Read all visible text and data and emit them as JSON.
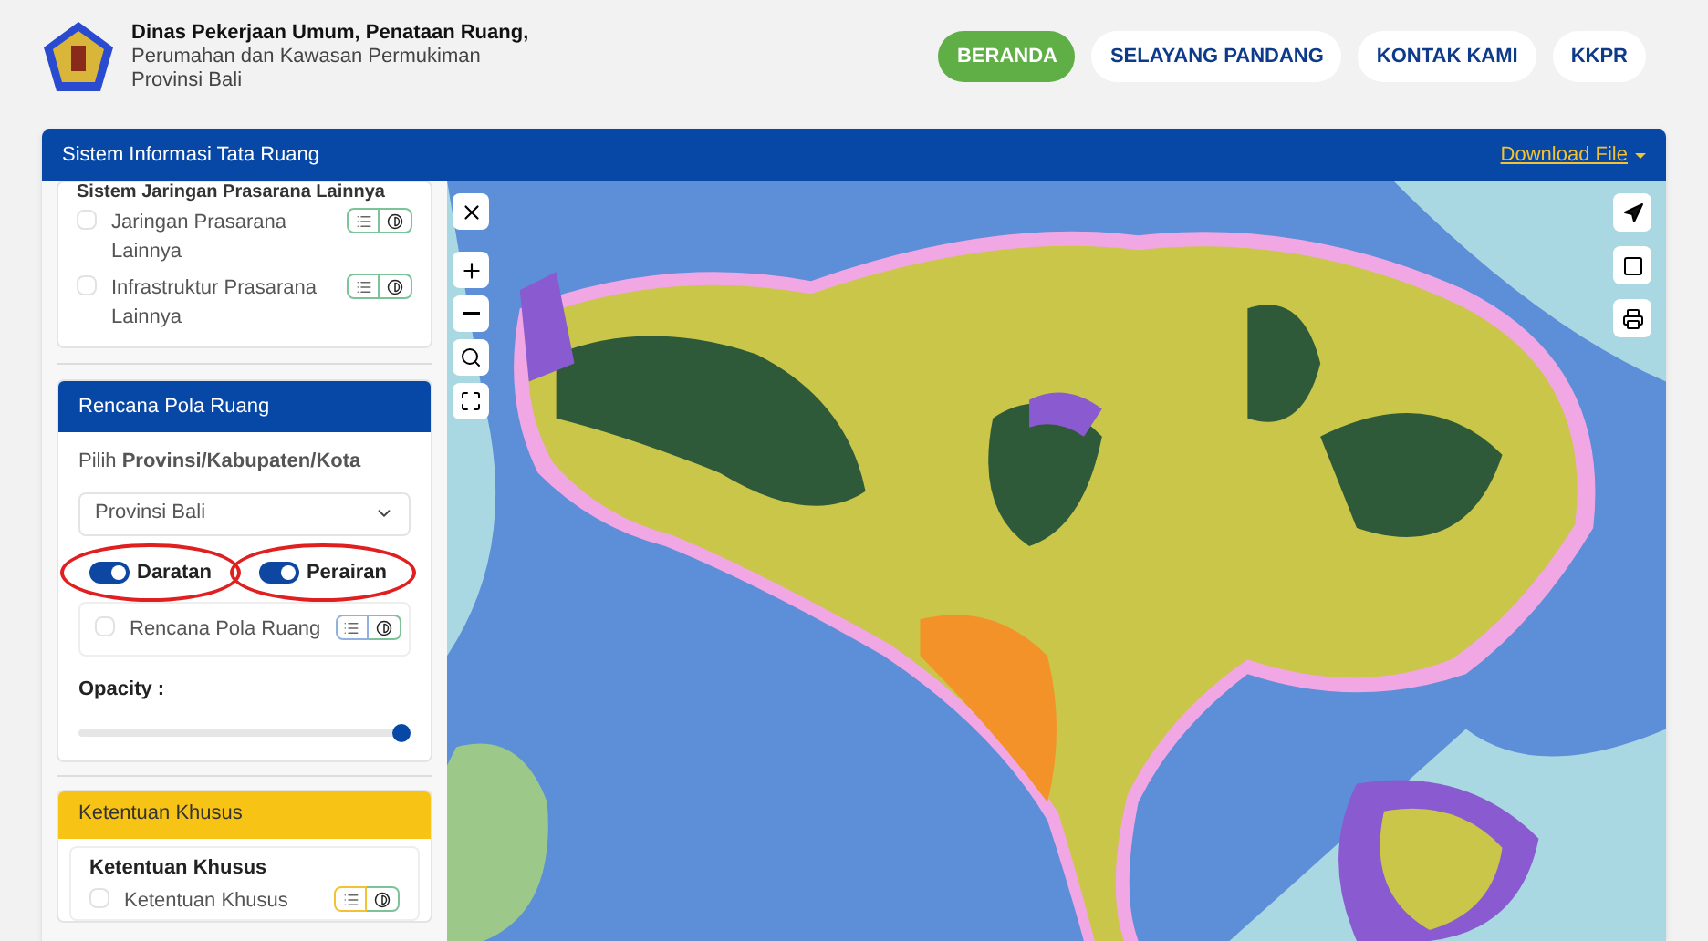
{
  "header": {
    "title": "Dinas Pekerjaan Umum, Penataan Ruang,",
    "subtitle_lines": [
      "Perumahan dan Kawasan Permukiman",
      "Provinsi Bali"
    ]
  },
  "nav": [
    {
      "label": "BERANDA",
      "selected": true
    },
    {
      "label": "SELAYANG PANDANG",
      "selected": false
    },
    {
      "label": "KONTAK KAMI",
      "selected": false
    },
    {
      "label": "KKPR",
      "selected": false
    }
  ],
  "panel": {
    "title": "Sistem Informasi Tata Ruang",
    "download": "Download File"
  },
  "sidebar": {
    "network_group": {
      "heading": "Sistem Jaringan Prasarana Lainnya",
      "layers": [
        {
          "label": "Jaringan Prasarana Lainnya",
          "checked": false
        },
        {
          "label": "Infrastruktur Prasarana Lainnya",
          "checked": false
        }
      ]
    },
    "pola_ruang": {
      "title": "Rencana Pola Ruang",
      "region_label": "Pilih **Provinsi/Kabupaten/Kota**",
      "region_value": "Provinsi Bali",
      "toggles": [
        {
          "label": "Daratan",
          "on": true,
          "circled": true
        },
        {
          "label": "Perairan",
          "on": true,
          "circled": true
        }
      ],
      "layers": [
        {
          "label": "Rencana Pola Ruang",
          "checked": false
        }
      ],
      "opacity_label": "Opacity :",
      "opacity": {
        "level": 1
      }
    },
    "ketentuan": {
      "title": "Ketentuan Khusus",
      "heading": "Ketentuan Khusus",
      "layers": [
        {
          "label": "Ketentuan Khusus",
          "checked": false
        }
      ]
    }
  }
}
